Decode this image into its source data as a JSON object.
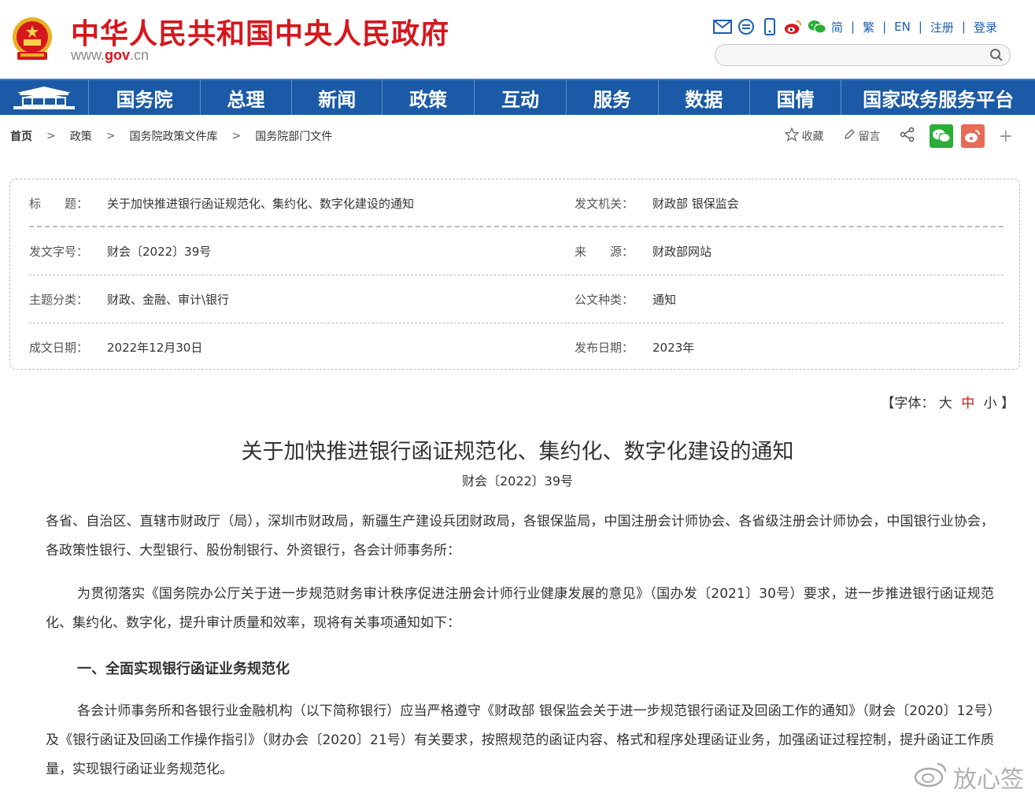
{
  "header": {
    "site_title": "中华人民共和国中央人民政府",
    "site_url_prefix": "www.",
    "site_url_gov": "gov",
    "site_url_suffix": ".cn",
    "tools": {
      "simplified": "简",
      "traditional": "繁",
      "english": "EN",
      "register": "注册",
      "login": "登录",
      "separator": "|"
    },
    "search_placeholder": ""
  },
  "nav": {
    "items": [
      "国务院",
      "总理",
      "新闻",
      "政策",
      "互动",
      "服务",
      "数据",
      "国情",
      "国家政务服务平台"
    ]
  },
  "breadcrumb": [
    "首页",
    "政策",
    "国务院政策文件库",
    "国务院部门文件"
  ],
  "breadcrumb_arrow": ">",
  "share": {
    "favorite": "收藏",
    "comment": "留言",
    "plus": "+"
  },
  "info": {
    "title_key": "标　　题：",
    "title_val": "关于加快推进银行函证规范化、集约化、数字化建设的通知",
    "issuer_key": "发文机关：",
    "issuer_val": "财政部  银保监会",
    "docno_key": "发文字号：",
    "docno_val": "财会〔2022〕39号",
    "source_key": "来　　源：",
    "source_val": "财政部网站",
    "topic_key": "主题分类：",
    "topic_val": "财政、金融、审计\\银行",
    "doctype_key": "公文种类：",
    "doctype_val": "通知",
    "date_key": "成文日期：",
    "date_val": "2022年12月30日",
    "pubdate_key": "发布日期：",
    "pubdate_val": "2023年"
  },
  "font_size": {
    "open": "【字体：",
    "large": "大",
    "medium": "中",
    "small": "小",
    "close": "】"
  },
  "article": {
    "title": "关于加快推进银行函证规范化、集约化、数字化建设的通知",
    "doc_no": "财会〔2022〕39号",
    "p1": "各省、自治区、直辖市财政厅（局），深圳市财政局，新疆生产建设兵团财政局，各银保监局，中国注册会计师协会、各省级注册会计师协会，中国银行业协会，各政策性银行、大型银行、股份制银行、外资银行，各会计师事务所：",
    "p2": "为贯彻落实《国务院办公厅关于进一步规范财务审计秩序促进注册会计师行业健康发展的意见》（国办发〔2021〕30号）要求，进一步推进银行函证规范化、集约化、数字化，提升审计质量和效率，现将有关事项通知如下：",
    "h1": "一、全面实现银行函证业务规范化",
    "p3": "各会计师事务所和各银行业金融机构（以下简称银行）应当严格遵守《财政部 银保监会关于进一步规范银行函证及回函工作的通知》（财会〔2020〕12号）及《银行函证及回函工作操作指引》（财办会〔2020〕21号）有关要求，按照规范的函证内容、格式和程序处理函证业务，加强函证过程控制，提升函证工作质量，实现银行函证业务规范化。"
  },
  "watermark": "放心签",
  "colors": {
    "brand_red": "#d5171d",
    "nav_blue": "#1b5aa6",
    "link_blue": "#1a5fb4"
  }
}
